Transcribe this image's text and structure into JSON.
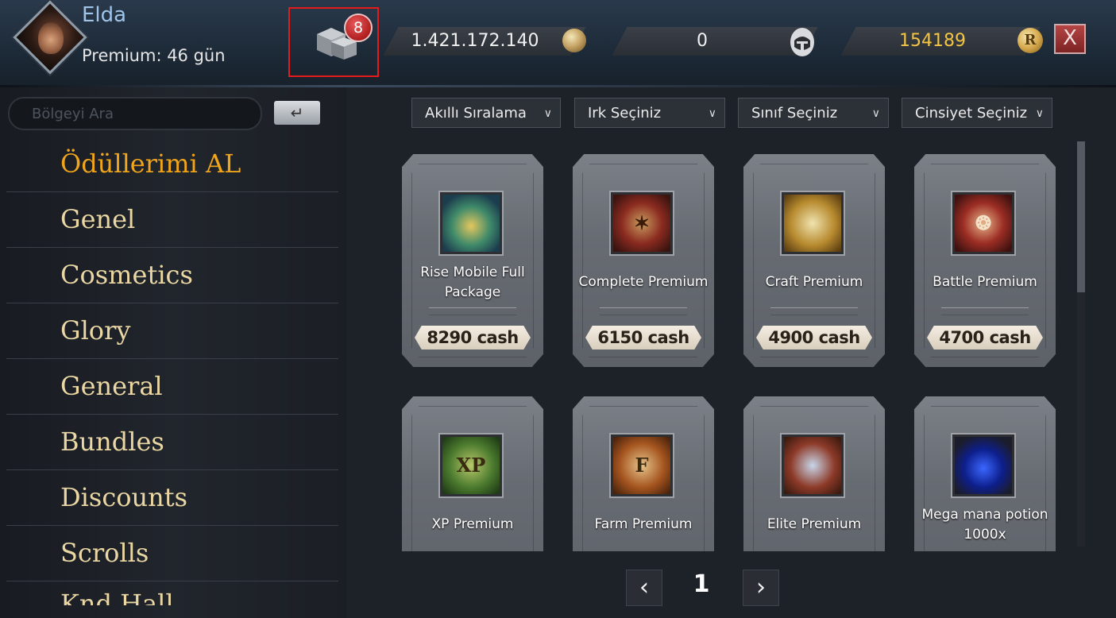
{
  "player": {
    "name": "Elda",
    "premium": "Premium: 46 gün"
  },
  "rewards": {
    "badge_count": "8",
    "icon": "gift-boxes-icon"
  },
  "currencies": [
    {
      "value": "1.421.172.140",
      "icon": "gold-coin-icon"
    },
    {
      "value": "0",
      "icon": "knight-helmet-icon"
    },
    {
      "value": "154189",
      "icon": "r-coin-icon"
    }
  ],
  "close_label": "X",
  "search": {
    "placeholder": "Bölgeyi Ara",
    "enter_symbol": "↵"
  },
  "menu": [
    "Ödüllerimi AL",
    "Genel",
    "Cosmetics",
    "Glory",
    "General",
    "Bundles",
    "Discounts",
    "Scrolls",
    "Knd Hall"
  ],
  "filters": [
    "Akıllı Sıralama",
    "Irk Seçiniz",
    "Sınıf Seçiniz",
    "Cinsiyet Seçiniz"
  ],
  "products": [
    {
      "name": "Rise Mobile Full Package",
      "price": "8290 cash",
      "icon": "treasure-chest-icon"
    },
    {
      "name": "Complete Premium",
      "price": "6150 cash",
      "icon": "scroll-icon"
    },
    {
      "name": "Craft Premium",
      "price": "4900 cash",
      "icon": "parchment-icon"
    },
    {
      "name": "Battle Premium",
      "price": "4700 cash",
      "icon": "battle-scroll-icon"
    },
    {
      "name": "XP Premium",
      "price": "",
      "icon": "xp-scroll-icon"
    },
    {
      "name": "Farm Premium",
      "price": "",
      "icon": "farm-scroll-icon"
    },
    {
      "name": "Elite Premium",
      "price": "",
      "icon": "elite-backpack-icon"
    },
    {
      "name": "Mega mana potion 1000x",
      "price": "",
      "icon": "mana-potion-icon"
    }
  ],
  "pagination": {
    "current": "1",
    "prev": "‹",
    "next": "›"
  },
  "colors": {
    "active_menu": "#f0a51a",
    "menu_text": "#ead7a4",
    "player_name": "#9fc4e8",
    "r_currency": "#f4c442",
    "highlight_box": "#e31b1b"
  }
}
